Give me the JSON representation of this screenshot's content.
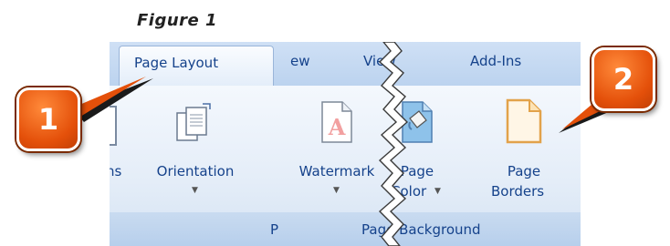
{
  "figure_caption": "Figure 1",
  "tabs": {
    "page_layout": "Page Layout",
    "review_fragment": "ew",
    "view": "View",
    "add_ins": "Add-Ins"
  },
  "buttons": {
    "margins_fragment": "ns",
    "orientation": "Orientation",
    "watermark": "Watermark",
    "page_color_line1": "Page",
    "page_color_line2": "Color",
    "page_borders_line1": "Page",
    "page_borders_line2": "Borders"
  },
  "groups": {
    "page_setup_fragment": "P",
    "page_background": "Page Background"
  },
  "callouts": {
    "one": "1",
    "two": "2"
  },
  "colors": {
    "callout": "#e4500a",
    "ribbon_text": "#15428b"
  },
  "icons": [
    "orientation-icon",
    "watermark-icon",
    "page-color-icon",
    "page-borders-icon",
    "dropdown-arrow-icon"
  ]
}
